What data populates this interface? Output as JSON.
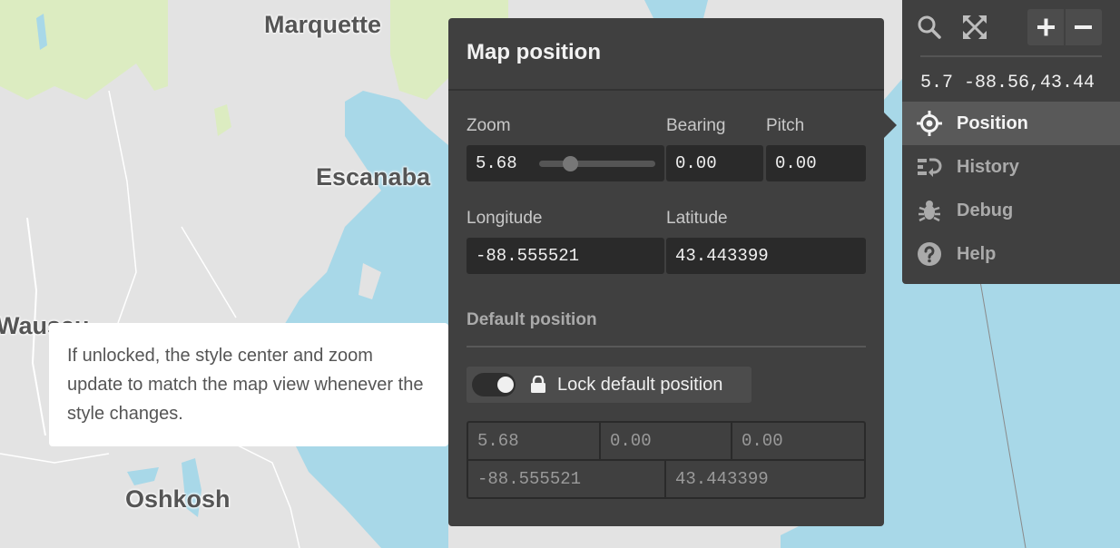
{
  "map": {
    "cities": [
      "Marquette",
      "Escanaba",
      "Wausau",
      "Oshkosh"
    ],
    "colors": {
      "land": "#e3e3e3",
      "water": "#a8d8e8",
      "forest": "#dcecc1",
      "roads": "#ffffff"
    }
  },
  "position_panel": {
    "title": "Map position",
    "zoom_label": "Zoom",
    "zoom_value": "5.68",
    "zoom_slider_fraction": 0.19,
    "bearing_label": "Bearing",
    "bearing_value": "0.00",
    "pitch_label": "Pitch",
    "pitch_value": "0.00",
    "longitude_label": "Longitude",
    "longitude_value": "-88.555521",
    "latitude_label": "Latitude",
    "latitude_value": "43.443399",
    "default_section_title": "Default position",
    "lock_label": "Lock default position",
    "lock_toggle_on": true,
    "default_zoom": "5.68",
    "default_bearing": "0.00",
    "default_pitch": "0.00",
    "default_longitude": "-88.555521",
    "default_latitude": "43.443399"
  },
  "tooltip": {
    "text": "If unlocked, the style center and zoom update to match the map view whenever the style changes."
  },
  "controls": {
    "icons": [
      "search-icon",
      "fullscreen-icon",
      "zoom-in-icon",
      "zoom-out-icon"
    ],
    "coords_readout": "5.7 -88.56,43.44",
    "menu": [
      {
        "label": "Position",
        "icon": "position-icon",
        "active": true
      },
      {
        "label": "History",
        "icon": "history-icon",
        "active": false
      },
      {
        "label": "Debug",
        "icon": "bug-icon",
        "active": false
      },
      {
        "label": "Help",
        "icon": "help-icon",
        "active": false
      }
    ]
  }
}
